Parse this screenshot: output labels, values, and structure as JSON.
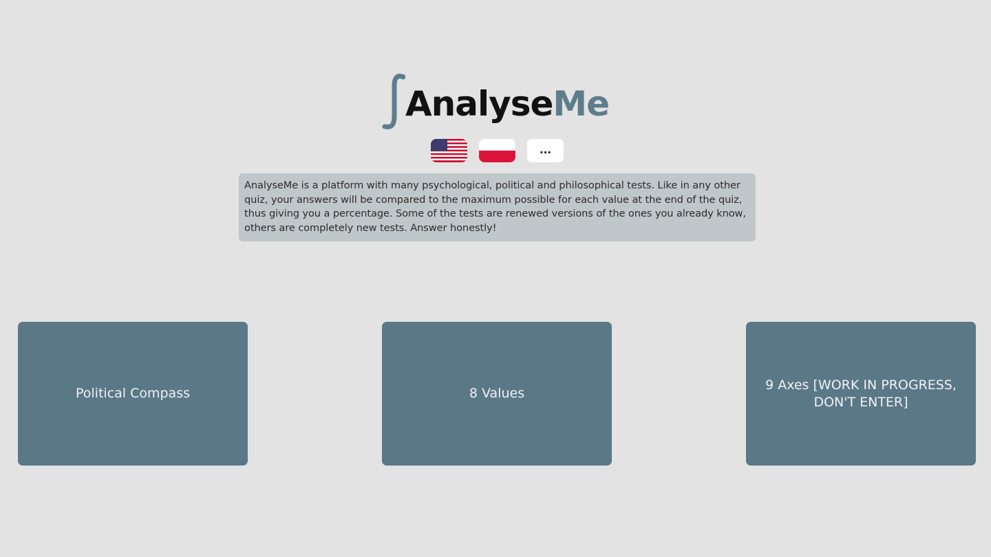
{
  "logo": {
    "part1": "Analyse",
    "part2": "Me"
  },
  "languages": [
    {
      "icon": "us-flag-icon"
    },
    {
      "icon": "poland-flag-icon"
    }
  ],
  "more_label": "...",
  "intro_text": "AnalyseMe is a platform with many psychological, political and philosophical tests. Like in any other quiz, your answers will be compared to the maximum possible for each value at the end of the quiz, thus giving you a percentage. Some of the tests are renewed versions of the ones you already know, others are completely new tests. Answer honestly!",
  "tests": [
    {
      "label": "Political Compass"
    },
    {
      "label": "8 Values"
    },
    {
      "label": "9 Axes [WORK IN PROGRESS, DON'T ENTER]"
    }
  ],
  "colors": {
    "background": "#e3e3e3",
    "card": "#5b7887",
    "accent": "#5d7d8b",
    "intro_box": "#c0c7ca"
  }
}
